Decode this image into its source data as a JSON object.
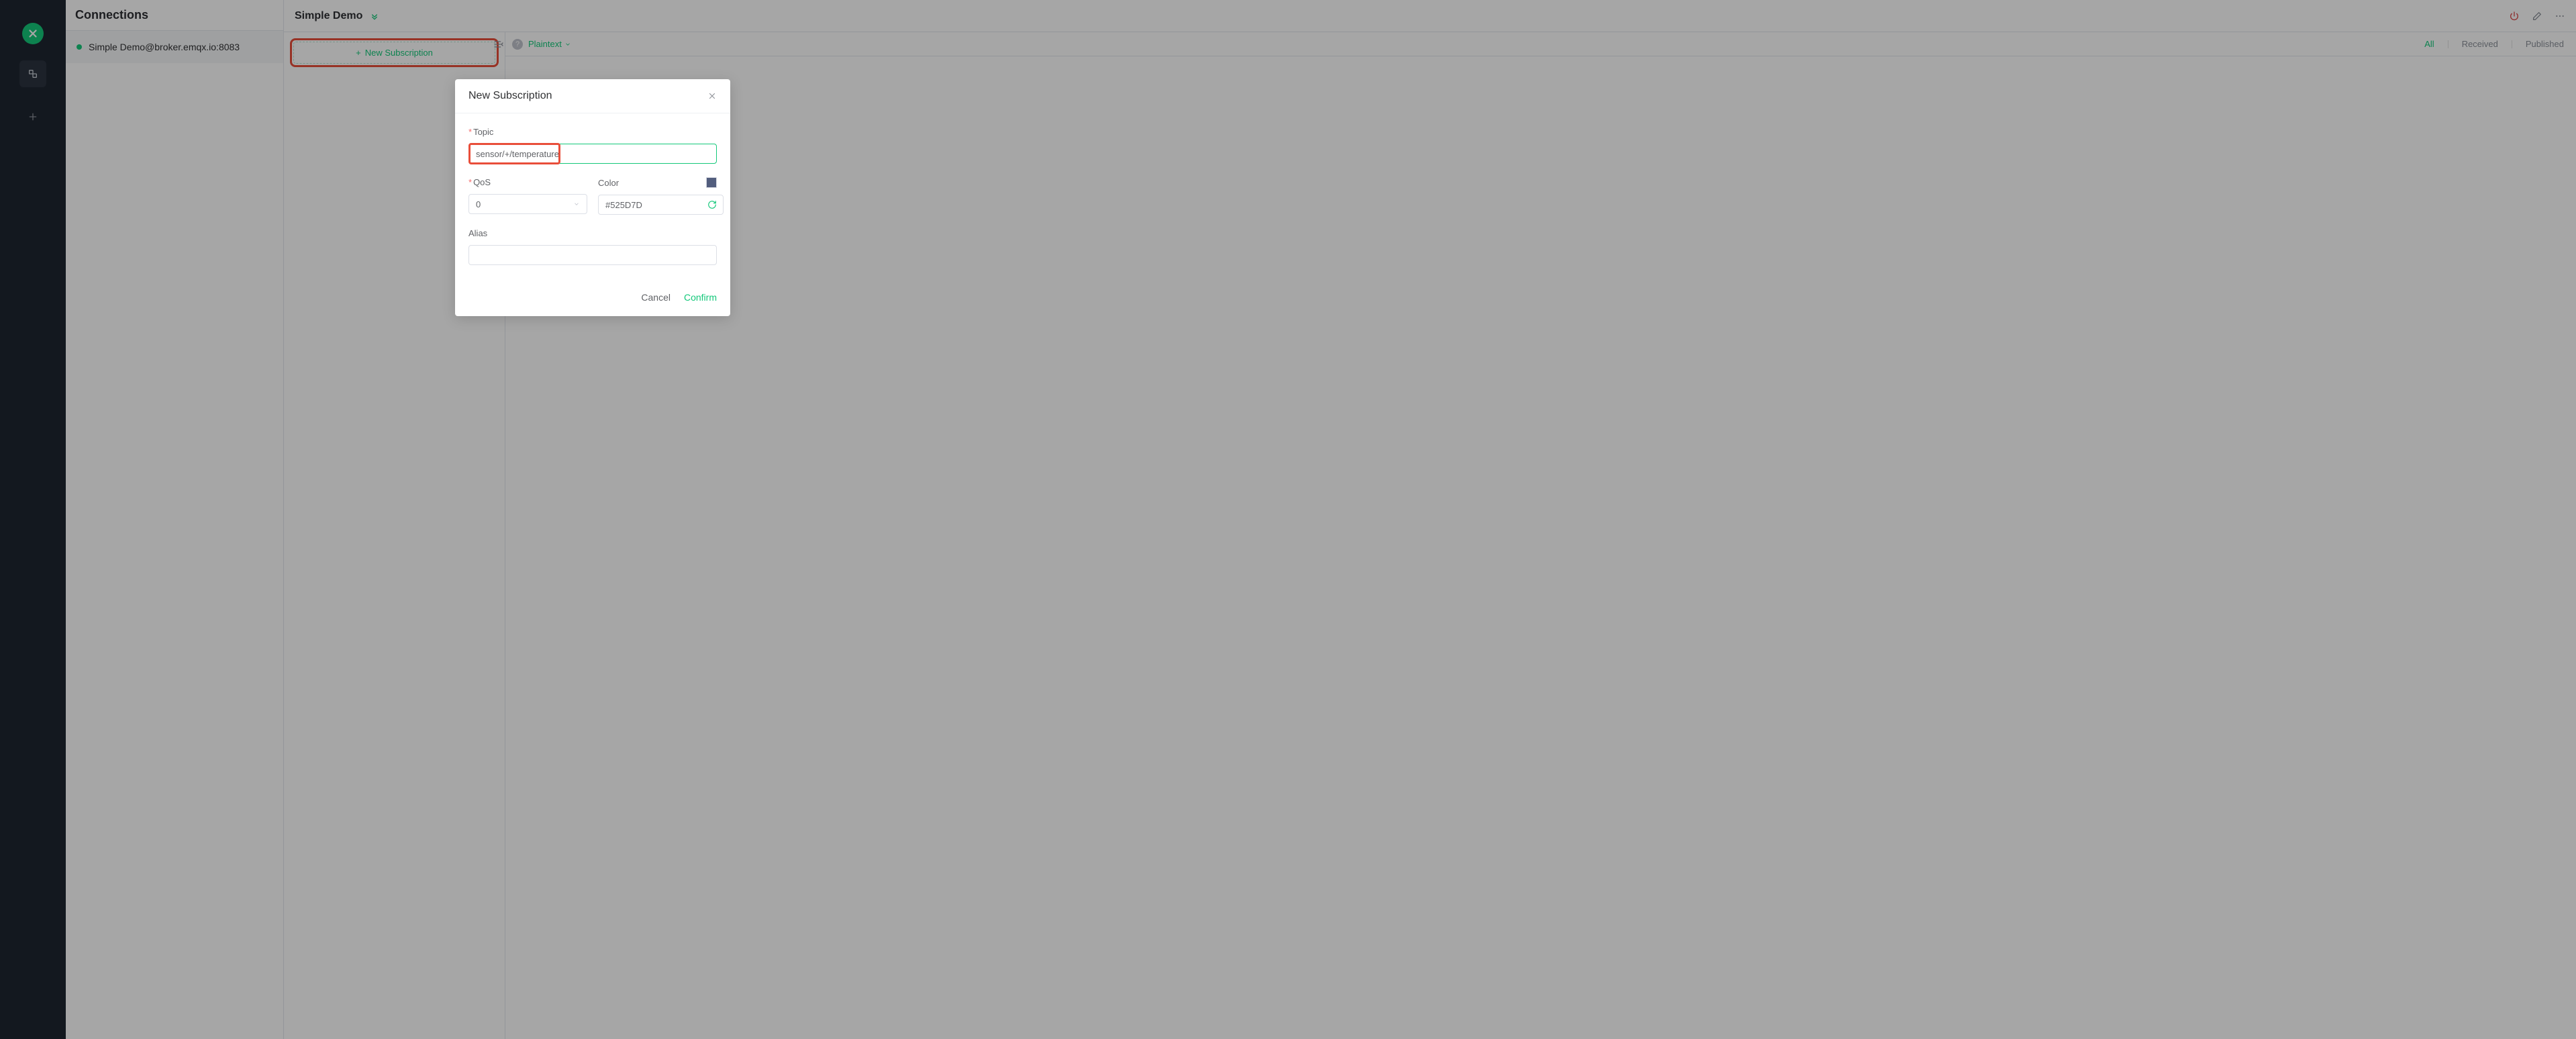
{
  "sidebar_title": "Connections",
  "connections": [
    {
      "name": "Simple Demo@broker.emqx.io:8083",
      "online": true
    }
  ],
  "detail": {
    "title": "Simple Demo",
    "new_subscription_label": "New Subscription",
    "payload_type": "Plaintext",
    "filters": {
      "all": "All",
      "received": "Received",
      "published": "Published",
      "active": "all"
    }
  },
  "modal": {
    "title": "New Subscription",
    "topic_label": "Topic",
    "topic_value": "sensor/+/temperature",
    "qos_label": "QoS",
    "qos_value": "0",
    "color_label": "Color",
    "color_value": "#525D7D",
    "alias_label": "Alias",
    "alias_value": "",
    "cancel": "Cancel",
    "confirm": "Confirm"
  }
}
